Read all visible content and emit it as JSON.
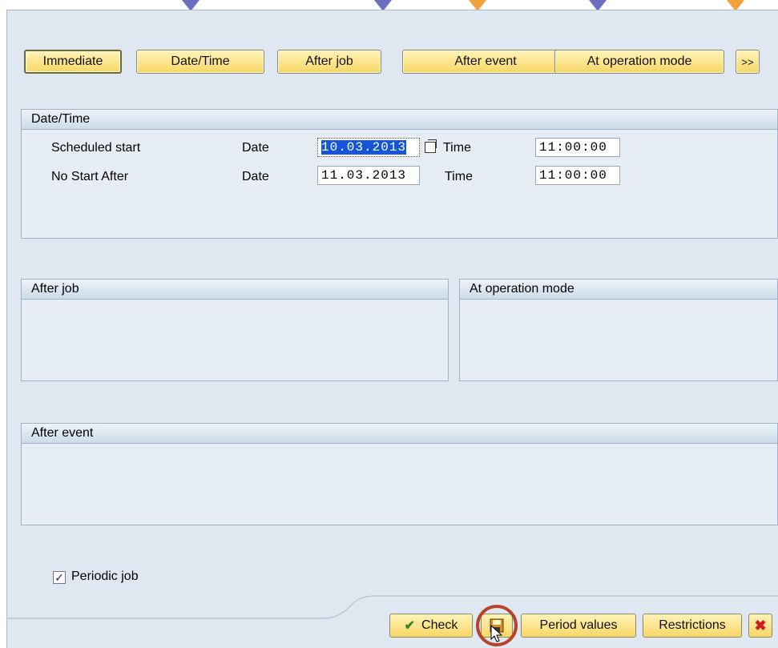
{
  "toolbar": {
    "immediate": "Immediate",
    "date_time": "Date/Time",
    "after_job": "After job",
    "after_event": "After event",
    "at_operation_mode": "At operation mode",
    "more": ">>"
  },
  "date_time_panel": {
    "title": "Date/Time",
    "rows": [
      {
        "label": "Scheduled start",
        "date_label": "Date",
        "date": "10.03.2013",
        "time_label": "Time",
        "time": "11:00:00"
      },
      {
        "label": "No Start After",
        "date_label": "Date",
        "date": "11.03.2013",
        "time_label": "Time",
        "time": "11:00:00"
      }
    ]
  },
  "after_job_panel": {
    "title": "After job"
  },
  "operation_mode_panel": {
    "title": "At operation mode"
  },
  "after_event_panel": {
    "title": "After event"
  },
  "periodic": {
    "label": "Periodic job",
    "checked": true
  },
  "footer": {
    "check": "Check",
    "period_values": "Period values",
    "restrictions": "Restrictions"
  },
  "icons": {
    "check": "checkmark-icon",
    "save": "save-icon",
    "cancel": "cancel-icon",
    "calendar": "calendar-icon"
  },
  "colors": {
    "button": "#f7d765",
    "panel_bg": "#e6edf4",
    "selection": "#1556d8",
    "highlight_ring": "#b5442a"
  }
}
